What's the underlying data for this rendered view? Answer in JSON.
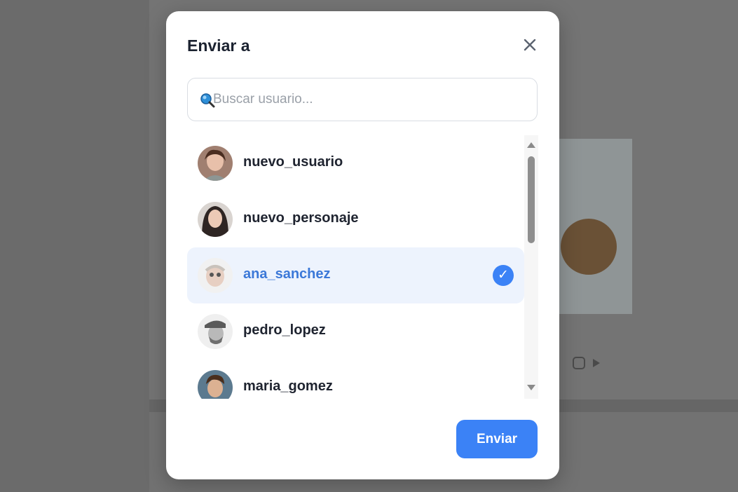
{
  "dialog": {
    "title": "Enviar a",
    "close_icon": "close-icon",
    "search": {
      "placeholder": "Buscar usuario...",
      "value": "",
      "icon": "search-icon"
    },
    "users": [
      {
        "username": "nuevo_usuario",
        "selected": false
      },
      {
        "username": "nuevo_personaje",
        "selected": false
      },
      {
        "username": "ana_sanchez",
        "selected": true
      },
      {
        "username": "pedro_lopez",
        "selected": false
      },
      {
        "username": "maria_gomez",
        "selected": false
      }
    ],
    "selected_mark": "✓",
    "send_label": "Enviar"
  },
  "colors": {
    "accent": "#3b82f6",
    "selected_row_bg": "#edf3fd",
    "selected_text": "#3b78d8",
    "overlay": "#6b6b6b"
  }
}
